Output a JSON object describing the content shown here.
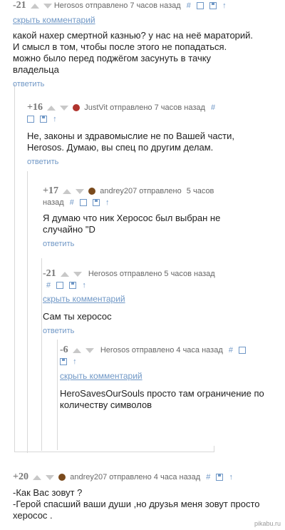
{
  "comments": [
    {
      "rating": "-21",
      "user": "Herosos",
      "posted": "отправлено",
      "time": "7 часов назад",
      "hide": "скрыть комментарий",
      "text": "какой нахер смертной казнью? у нас на неё мараторий.\nИ смысл в том, чтобы после этого не попадаться.\nможно было перед поджёгом засунуть в тачку\nвладельца",
      "reply": "ответить"
    },
    {
      "rating": "+16",
      "user": "JustVit",
      "posted": "отправлено",
      "time": "7 часов назад",
      "text": "Не, законы и здравомыслие не по Вашей части,\nHerosos. Думаю, вы спец по другим делам.",
      "reply": "ответить"
    },
    {
      "rating": "+17",
      "user": "andrey207",
      "posted": "отправлено",
      "time_a": "5 часов",
      "time_b": "назад",
      "text": "Я думаю что ник Херосос был выбран не\nслучайно \"D",
      "reply": "ответить"
    },
    {
      "rating": "-21",
      "user": "Herosos",
      "posted": "отправлено",
      "time": "5 часов назад",
      "hide": "скрыть комментарий",
      "text": "Сам ты херосос",
      "reply": "ответить"
    },
    {
      "rating": "-6",
      "user": "Herosos",
      "posted": "отправлено",
      "time": "4 часа назад",
      "hide": "скрыть комментарий",
      "text": "HeroSavesOurSouls просто там ограничение по\nколичеству символов",
      "reply": "ответить"
    },
    {
      "rating": "+20",
      "user": "andrey207",
      "posted": "отправлено",
      "time": "4 часа назад",
      "text": "-Как Вас зовут ?\n-Герой спасший ваши души ,но друзья меня зовут просто херосос ."
    }
  ],
  "tools": {
    "hash": "#",
    "up": "↑"
  },
  "watermark": "pikabu.ru",
  "colors": {
    "link": "#6f97c6",
    "arrow": "#c8c8c8",
    "thread_line": "#d8d8d8"
  }
}
